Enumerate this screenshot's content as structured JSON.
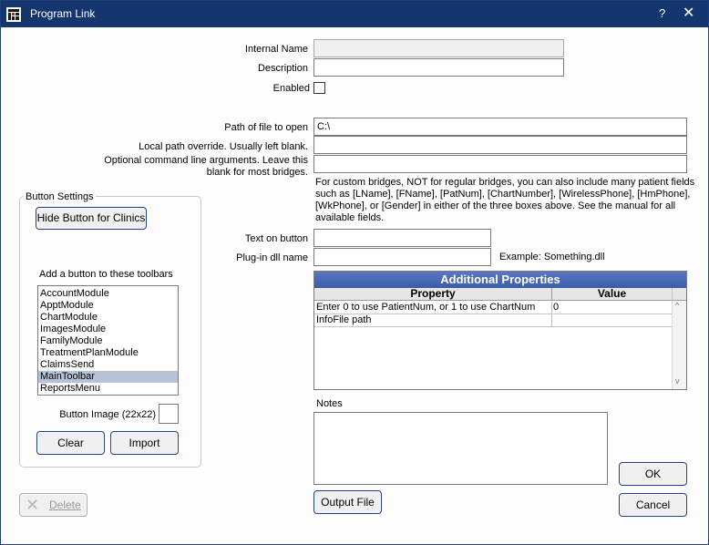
{
  "window": {
    "title": "Program Link",
    "help_glyph": "?",
    "close_glyph": "✕"
  },
  "fields": {
    "internal_name_label": "Internal Name",
    "internal_name_value": "",
    "description_label": "Description",
    "description_value": "",
    "enabled_label": "Enabled",
    "path_label": "Path of file to open",
    "path_value": "C:\\",
    "local_path_label": "Local path override.  Usually left blank.",
    "local_path_value": "",
    "cmd_args_label_line1": "Optional command line arguments.  Leave this",
    "cmd_args_label_line2": "blank for most bridges.",
    "cmd_args_value": "",
    "help_text_lines": [
      "For custom bridges, NOT for regular bridges, you can also include many patient fields",
      "such as [LName], [FName], [PatNum], [ChartNumber], [WirelessPhone], [HmPhone],",
      "[WkPhone], or [Gender] in either of the three boxes above. See the manual for all",
      "available fields."
    ],
    "text_on_button_label": "Text on button",
    "text_on_button_value": "",
    "plugin_dll_label": "Plug-in dll name",
    "plugin_dll_value": "",
    "plugin_example": "Example: Something.dll"
  },
  "button_settings": {
    "title": "Button Settings",
    "hide_button": "Hide Button for Clinics",
    "toolbars_label": "Add a button to these toolbars",
    "toolbars": [
      "AccountModule",
      "ApptModule",
      "ChartModule",
      "ImagesModule",
      "FamilyModule",
      "TreatmentPlanModule",
      "ClaimsSend",
      "MainToolbar",
      "ReportsMenu"
    ],
    "selected_toolbar": "MainToolbar",
    "button_image_label": "Button Image (22x22)",
    "clear": "Clear",
    "import": "Import"
  },
  "additional_properties": {
    "title": "Additional Properties",
    "col_property": "Property",
    "col_value": "Value",
    "rows": [
      {
        "property": "Enter 0 to use PatientNum, or 1 to use ChartNum",
        "value": "0"
      },
      {
        "property": "InfoFile path",
        "value": ""
      }
    ]
  },
  "notes": {
    "label": "Notes",
    "value": ""
  },
  "buttons": {
    "output_file": "Output File",
    "ok": "OK",
    "cancel": "Cancel",
    "delete": "Delete"
  },
  "colors": {
    "titlebar": "#15356f",
    "grid_header": "#3b5ba8",
    "selection": "#b6c2d8",
    "button_border": "#1c3f86"
  }
}
